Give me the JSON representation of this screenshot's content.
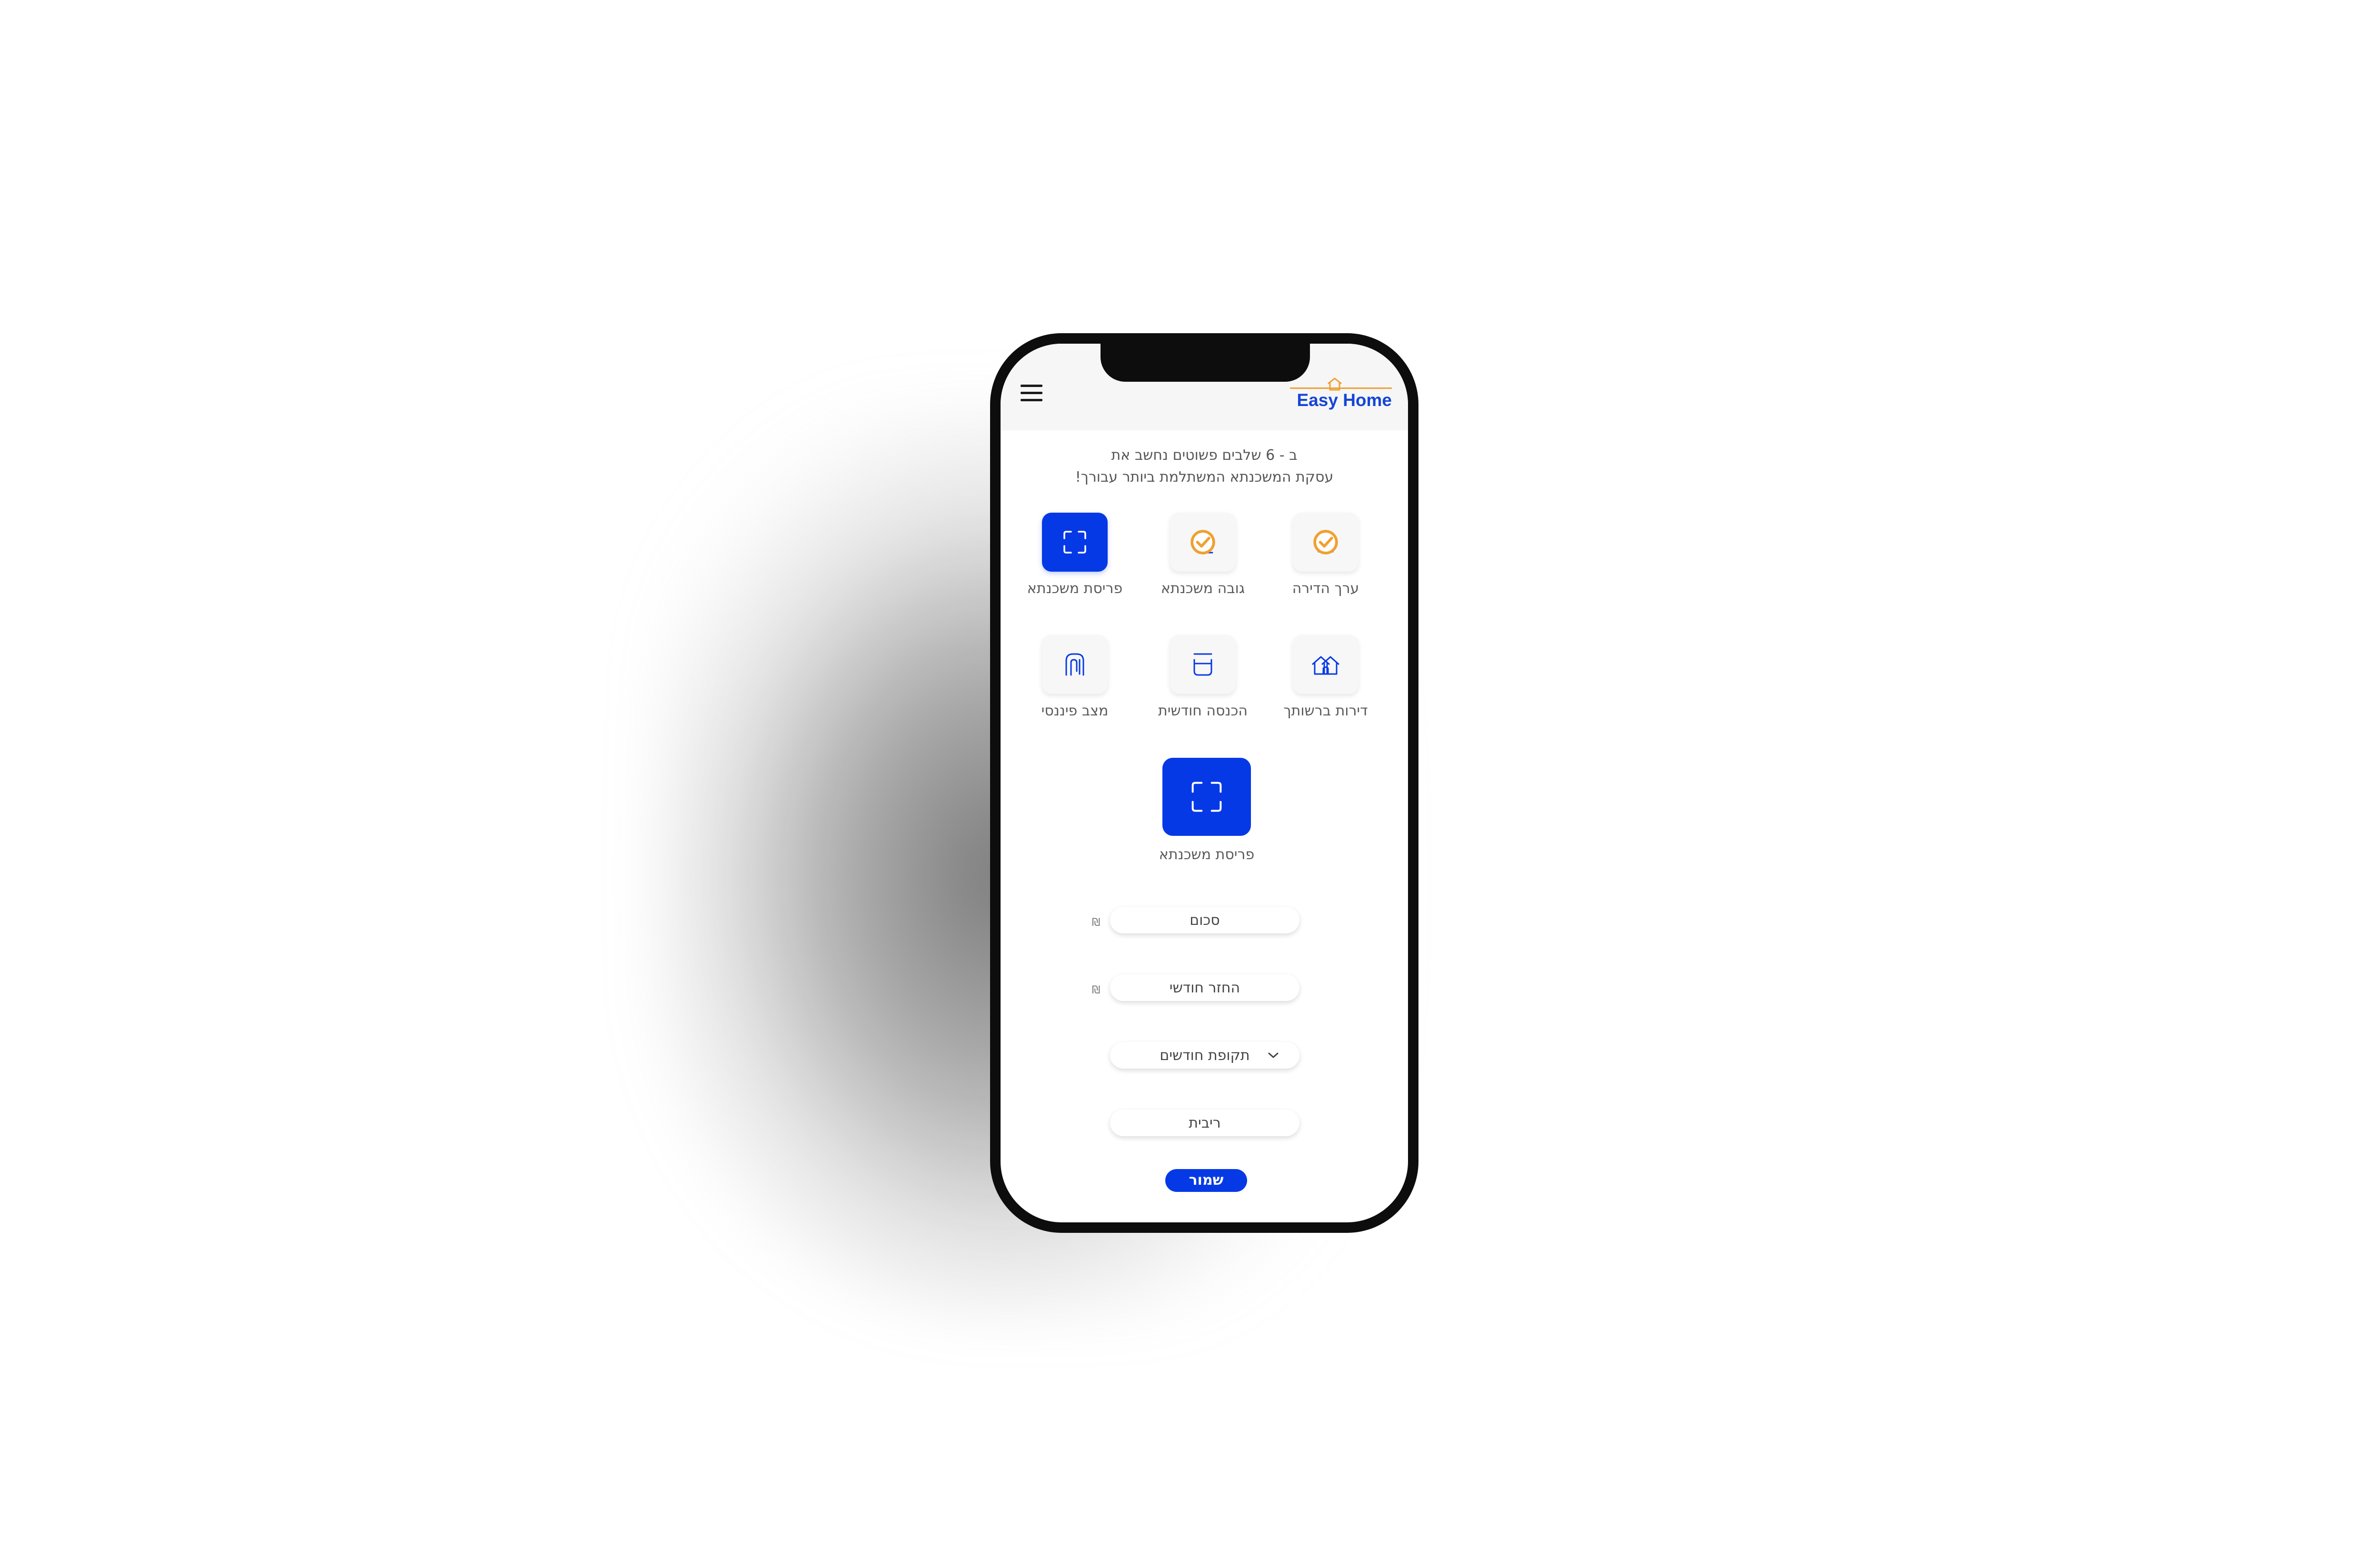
{
  "app": {
    "logo_text": "Easy Home"
  },
  "colors": {
    "primary": "#0639e6",
    "logo_blue": "#1545d6",
    "accent_orange": "#f0a030",
    "text_gray": "#555555",
    "topbar_bg": "#f6f6f6"
  },
  "intro": {
    "line1": "ב - 6 שלבים פשוטים נחשב את",
    "line2": "עסקת המשכנתא המשתלמת ביותר עבורך!"
  },
  "steps": [
    {
      "label": "ערך הדירה",
      "icon": "house-icon",
      "completed": true,
      "active": false
    },
    {
      "label": "גובה משכנתא",
      "icon": "arrow-up-icon",
      "completed": true,
      "active": false
    },
    {
      "label": "פריסת משכנתא",
      "icon": "frame-icon",
      "completed": false,
      "active": true
    },
    {
      "label": "דירות ברשותך",
      "icon": "houses-icon",
      "completed": false,
      "active": false
    },
    {
      "label": "הכנסה חודשית",
      "icon": "tray-icon",
      "completed": false,
      "active": false
    },
    {
      "label": "מצב פיננסי",
      "icon": "clip-icon",
      "completed": false,
      "active": false
    }
  ],
  "current_step": {
    "label": "פריסת משכנתא",
    "icon": "frame-icon"
  },
  "form": {
    "amount_placeholder": "סכום",
    "monthly_placeholder": "החזר חודשי",
    "period_label": "תקופת חודשים",
    "interest_placeholder": "ריבית",
    "currency_symbol": "₪",
    "save_label": "שמור"
  }
}
